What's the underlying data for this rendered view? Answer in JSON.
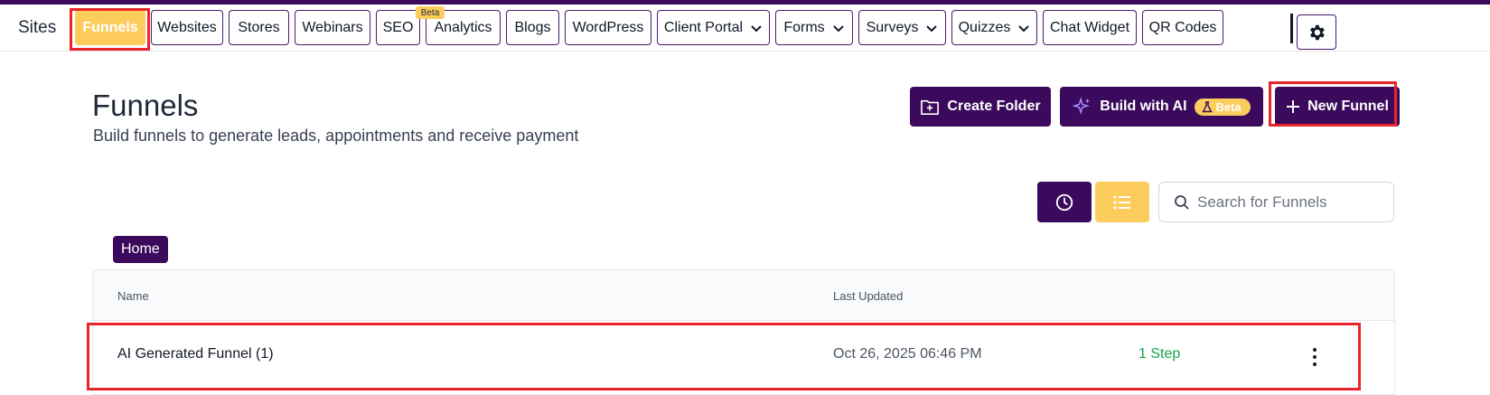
{
  "nav": {
    "sites_label": "Sites",
    "tabs": [
      {
        "label": "Funnels",
        "active": true
      },
      {
        "label": "Websites"
      },
      {
        "label": "Stores"
      },
      {
        "label": "Webinars"
      },
      {
        "label": "SEO",
        "badge": "Beta"
      },
      {
        "label": "Analytics"
      },
      {
        "label": "Blogs"
      },
      {
        "label": "WordPress"
      },
      {
        "label": "Client Portal",
        "dropdown": true
      },
      {
        "label": "Forms",
        "dropdown": true
      },
      {
        "label": "Surveys",
        "dropdown": true
      },
      {
        "label": "Quizzes",
        "dropdown": true
      },
      {
        "label": "Chat Widget"
      },
      {
        "label": "QR Codes"
      }
    ],
    "settings_icon": "gear-icon"
  },
  "header": {
    "title": "Funnels",
    "subtitle": "Build funnels to generate leads, appointments and receive payment"
  },
  "actions": {
    "create_folder": "Create Folder",
    "build_with_ai": "Build with AI",
    "build_with_ai_badge": "Beta",
    "new_funnel": "New Funnel"
  },
  "toolbar": {
    "search_placeholder": "Search for Funnels"
  },
  "breadcrumb": {
    "home": "Home"
  },
  "table": {
    "columns": [
      "Name",
      "Last Updated"
    ],
    "rows": [
      {
        "name": "AI Generated Funnel (1)",
        "last_updated": "Oct 26, 2025 06:46 PM",
        "steps": "1 Step"
      }
    ]
  },
  "colors": {
    "brand": "#3b0a5c",
    "accent": "#fccc5c",
    "success": "#16a34a",
    "highlight": "#e8252b"
  }
}
